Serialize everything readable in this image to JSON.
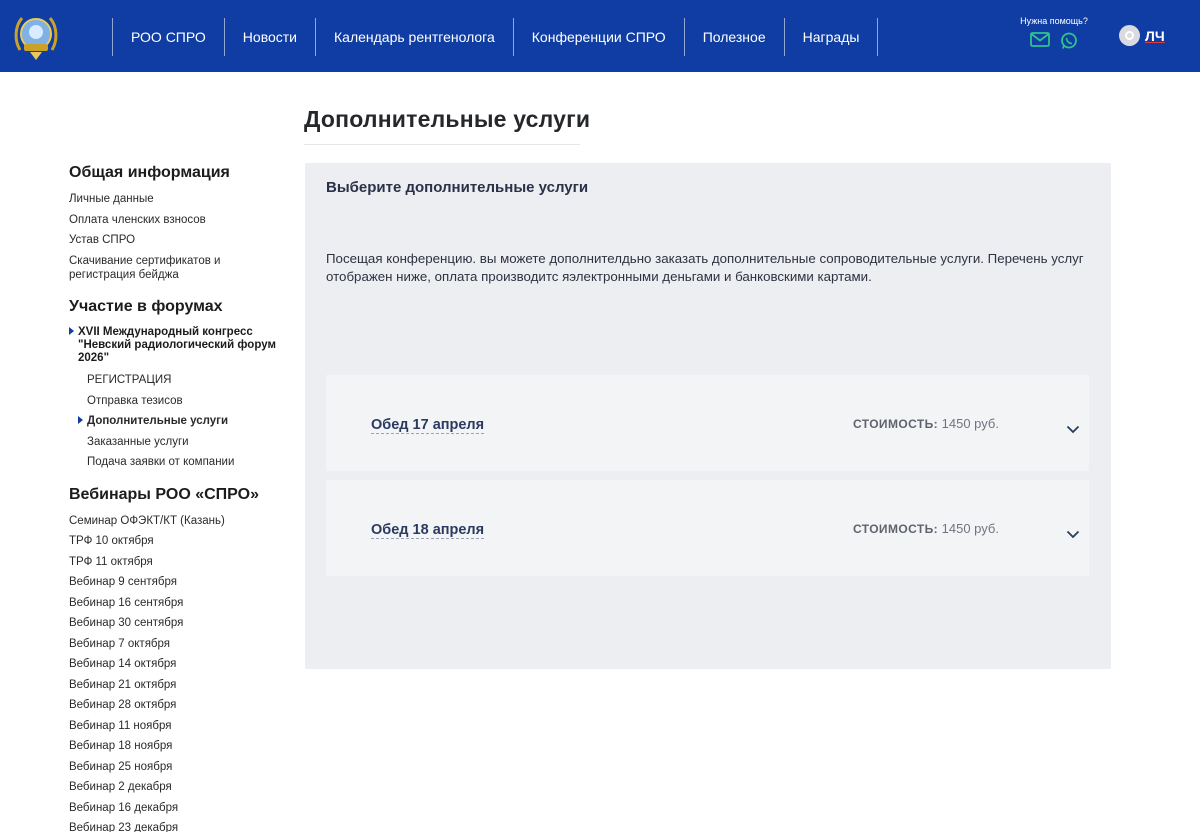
{
  "header": {
    "logo_icon": "association-emblem-icon",
    "nav": [
      {
        "label": "РОО СПРО"
      },
      {
        "label": "Новости"
      },
      {
        "label": "Календарь рентгенолога"
      },
      {
        "label": "Конференции СПРО"
      },
      {
        "label": "Полезное"
      },
      {
        "label": "Награды"
      }
    ],
    "help_label": "Нужна помощь?",
    "help_icons": [
      "mail-icon",
      "whatsapp-icon"
    ],
    "account_label": "ЛЧ",
    "colors": {
      "bar": "#0f3da3",
      "help_icons": "#2ec48c"
    }
  },
  "page_title": "Дополнительные услуги",
  "sidebar": {
    "general": {
      "heading": "Общая информация",
      "links": [
        "Личные данные",
        "Оплата членских взносов",
        "Устав СПРО",
        "Скачивание сертификатов и регистрация бейджа"
      ]
    },
    "forums": {
      "heading": "Участие в форумах",
      "congress": "XVII Международный конгресс \"Невский радиологический форум 2026\"",
      "sub_links": [
        "РЕГИСТРАЦИЯ",
        "Отправка тезисов",
        "Дополнительные услуги",
        "Заказанные услуги",
        "Подача заявки от компании"
      ],
      "active_sub": "Дополнительные услуги"
    },
    "webinars": {
      "heading": "Вебинары РОО «СПРО»",
      "links": [
        "Семинар ОФЭКТ/КТ (Казань)",
        "ТРФ 10 октября",
        "ТРФ 11 октября",
        "Вебинар 9 сентября",
        "Вебинар 16 сентября",
        "Вебинар 30 сентября",
        "Вебинар 7 октября",
        "Вебинар 14 октября",
        "Вебинар 21 октября",
        "Вебинар 28 октября",
        "Вебинар 11 ноября",
        "Вебинар 18 ноября",
        "Вебинар 25 ноября",
        "Вебинар 2 декабря",
        "Вебинар 16 декабря",
        "Вебинар 23 декабря"
      ]
    }
  },
  "main": {
    "title": "Выберите дополнительные услуги",
    "description": "Посещая конференцию. вы можете дополнителдьно заказать дополнительные сопроводительные услуги. Перечень услуг отображен ниже, оплата производитс яэлектронными деньгами и банковскими картами.",
    "services": [
      {
        "name": "Обед 17 апреля",
        "price_label": "СТОИМОСТЬ:",
        "price": "1450 руб."
      },
      {
        "name": "Обед 18 апреля",
        "price_label": "СТОИМОСТЬ:",
        "price": "1450 руб."
      }
    ]
  }
}
